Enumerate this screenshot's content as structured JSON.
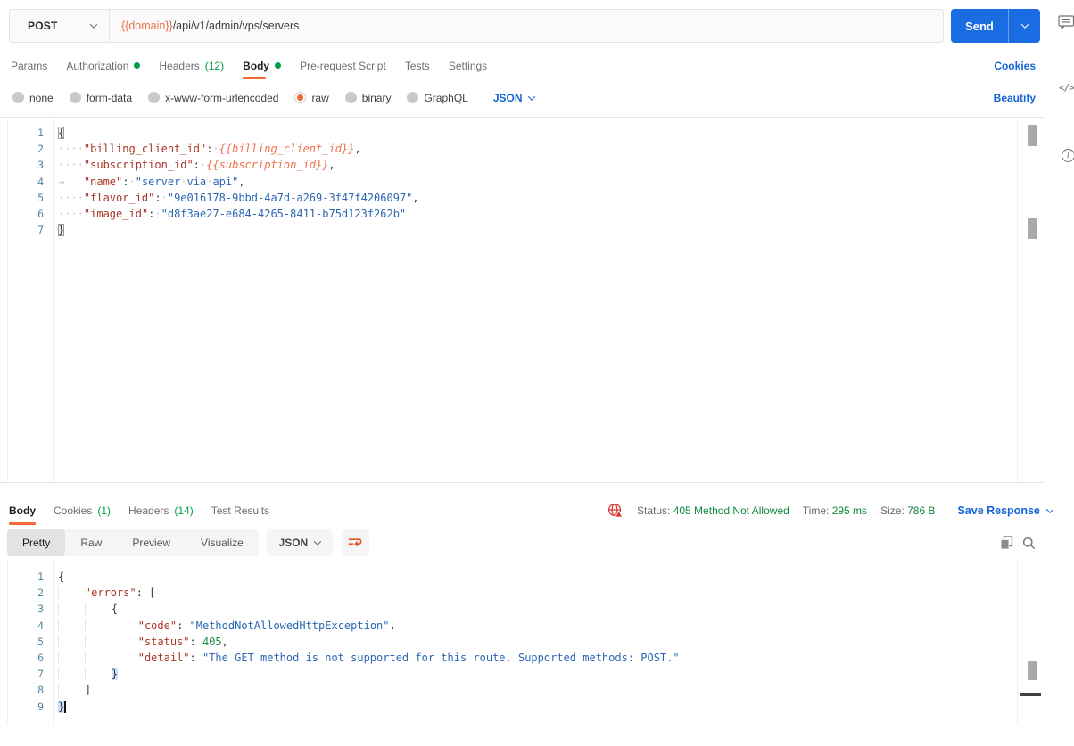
{
  "colors": {
    "orange": "#F26937",
    "blue": "#1A6CE3",
    "link_blue": "#1565D8",
    "green": "#00A047",
    "status_green": "#0E8A3E",
    "error_red": "#D9342B"
  },
  "request_bar": {
    "method": "POST",
    "url_domain": "{{domain}}",
    "url_path": "/api/v1/admin/vps/servers",
    "send_label": "Send"
  },
  "request_tabs": {
    "items": [
      {
        "label": "Params"
      },
      {
        "label": "Authorization",
        "dot": true
      },
      {
        "label": "Headers",
        "count": "(12)"
      },
      {
        "label": "Body",
        "dot": true,
        "active": true
      },
      {
        "label": "Pre-request Script"
      },
      {
        "label": "Tests"
      },
      {
        "label": "Settings"
      }
    ],
    "cookies_link": "Cookies"
  },
  "body_type_bar": {
    "options": [
      {
        "label": "none"
      },
      {
        "label": "form-data"
      },
      {
        "label": "x-www-form-urlencoded"
      },
      {
        "label": "raw",
        "selected": true
      },
      {
        "label": "binary"
      },
      {
        "label": "GraphQL"
      }
    ],
    "language": "JSON",
    "beautify_link": "Beautify"
  },
  "request_editor": {
    "lines": [
      [
        [
          "mb",
          "{"
        ]
      ],
      [
        [
          "ws",
          "····"
        ],
        [
          "key",
          "\"billing_client_id\""
        ],
        [
          "punct",
          ":"
        ],
        [
          "ws",
          "·"
        ],
        [
          "var",
          "{{billing_client_id}}"
        ],
        [
          "punct",
          ","
        ]
      ],
      [
        [
          "ws",
          "····"
        ],
        [
          "key",
          "\"subscription_id\""
        ],
        [
          "punct",
          ":"
        ],
        [
          "ws",
          "·"
        ],
        [
          "var",
          "{{subscription_id}}"
        ],
        [
          "punct",
          ","
        ]
      ],
      [
        [
          "tab",
          "→   "
        ],
        [
          "key",
          "\"name\""
        ],
        [
          "punct",
          ":"
        ],
        [
          "ws",
          "·"
        ],
        [
          "str",
          "\"server"
        ],
        [
          "sdot",
          "·"
        ],
        [
          "str",
          "via"
        ],
        [
          "sdot",
          "·"
        ],
        [
          "str",
          "api\""
        ],
        [
          "punct",
          ","
        ]
      ],
      [
        [
          "ws",
          "····"
        ],
        [
          "key",
          "\"flavor_id\""
        ],
        [
          "punct",
          ":"
        ],
        [
          "ws",
          "·"
        ],
        [
          "str",
          "\"9e016178-9bbd-4a7d-a269-3f47f4206097\""
        ],
        [
          "punct",
          ","
        ]
      ],
      [
        [
          "ws",
          "····"
        ],
        [
          "key",
          "\"image_id\""
        ],
        [
          "punct",
          ":"
        ],
        [
          "ws",
          "·"
        ],
        [
          "str",
          "\"d8f3ae27-e684-4265-8411-b75d123f262b\""
        ]
      ],
      [
        [
          "mb",
          "}"
        ]
      ]
    ]
  },
  "response_section": {
    "tabs": [
      {
        "label": "Body",
        "active": true
      },
      {
        "label": "Cookies",
        "count": "(1)"
      },
      {
        "label": "Headers",
        "count": "(14)"
      },
      {
        "label": "Test Results"
      }
    ],
    "status_label": "Status:",
    "status_value": "405 Method Not Allowed",
    "time_label": "Time:",
    "time_value": "295 ms",
    "size_label": "Size:",
    "size_value": "786 B",
    "save_response_label": "Save Response",
    "views": [
      {
        "label": "Pretty",
        "active": true
      },
      {
        "label": "Raw"
      },
      {
        "label": "Preview"
      },
      {
        "label": "Visualize"
      }
    ],
    "language": "JSON"
  },
  "response_editor": {
    "lines": [
      [
        [
          "punct",
          "{"
        ]
      ],
      [
        [
          "ind",
          "    "
        ],
        [
          "key",
          "\"errors\""
        ],
        [
          "punct",
          ": ["
        ]
      ],
      [
        [
          "ind",
          "    "
        ],
        [
          "ind",
          "    "
        ],
        [
          "punct",
          "{"
        ]
      ],
      [
        [
          "ind",
          "    "
        ],
        [
          "ind",
          "    "
        ],
        [
          "ind",
          "    "
        ],
        [
          "key",
          "\"code\""
        ],
        [
          "punct",
          ": "
        ],
        [
          "str",
          "\"MethodNotAllowedHttpException\""
        ],
        [
          "punct",
          ","
        ]
      ],
      [
        [
          "ind",
          "    "
        ],
        [
          "ind",
          "    "
        ],
        [
          "ind",
          "    "
        ],
        [
          "key",
          "\"status\""
        ],
        [
          "punct",
          ": "
        ],
        [
          "num",
          "405"
        ],
        [
          "punct",
          ","
        ]
      ],
      [
        [
          "ind",
          "    "
        ],
        [
          "ind",
          "    "
        ],
        [
          "ind",
          "    "
        ],
        [
          "key",
          "\"detail\""
        ],
        [
          "punct",
          ": "
        ],
        [
          "str",
          "\"The GET method is not supported for this route. Supported methods: POST.\""
        ]
      ],
      [
        [
          "ind",
          "    "
        ],
        [
          "ind",
          "    "
        ],
        [
          "mbfill",
          "}"
        ]
      ],
      [
        [
          "ind",
          "    "
        ],
        [
          "punct",
          "]"
        ]
      ],
      [
        [
          "mbfill",
          "}"
        ],
        [
          "cursor",
          ""
        ]
      ]
    ]
  },
  "icons": {
    "network_error_icon": "globe-warning",
    "wrap_icon": "wrap-text",
    "copy_icon": "copy",
    "search_icon": "search",
    "comment_icon": "comment",
    "code_icon": "code-snippet",
    "info_icon": "info"
  }
}
